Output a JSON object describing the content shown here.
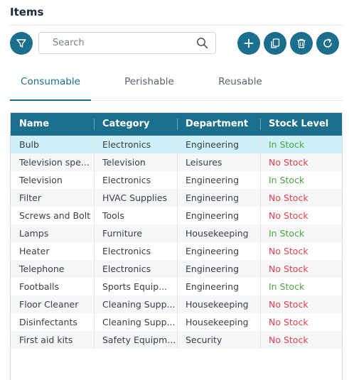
{
  "page": {
    "title": "Items"
  },
  "toolbar": {
    "filter_icon": "filter-icon",
    "search_placeholder": "Search",
    "search_value": "",
    "search_icon": "search-icon",
    "actions": [
      {
        "name": "add-button",
        "icon": "plus-icon"
      },
      {
        "name": "copy-button",
        "icon": "copy-icon"
      },
      {
        "name": "delete-button",
        "icon": "trash-icon"
      },
      {
        "name": "refresh-button",
        "icon": "refresh-icon"
      }
    ],
    "accent_color": "#1b6e8c"
  },
  "tabs": [
    {
      "label": "Consumable",
      "active": true
    },
    {
      "label": "Perishable",
      "active": false
    },
    {
      "label": "Reusable",
      "active": false
    }
  ],
  "table": {
    "columns": [
      "Name",
      "Category",
      "Department",
      "Stock Level"
    ],
    "rows": [
      {
        "name": "Bulb",
        "category": "Electronics",
        "department": "Engineering",
        "stock": "In Stock",
        "selected": true
      },
      {
        "name": "Television spe...",
        "category": "Television",
        "department": "Leisures",
        "stock": "No Stock"
      },
      {
        "name": "Television",
        "category": "Electronics",
        "department": "Engineering",
        "stock": "In Stock"
      },
      {
        "name": "Filter",
        "category": "HVAC Supplies",
        "department": "Engineering",
        "stock": "No Stock"
      },
      {
        "name": "Screws and Bolt",
        "category": "Tools",
        "department": "Engineering",
        "stock": "No Stock"
      },
      {
        "name": "Lamps",
        "category": "Furniture",
        "department": "Housekeeping",
        "stock": "In Stock"
      },
      {
        "name": "Heater",
        "category": "Electronics",
        "department": "Engineering",
        "stock": "No Stock"
      },
      {
        "name": "Telephone",
        "category": "Electronics",
        "department": "Engineering",
        "stock": "No Stock"
      },
      {
        "name": "Footballs",
        "category": "Sports Equip...",
        "department": "Engineering",
        "stock": "In Stock"
      },
      {
        "name": "Floor Cleaner",
        "category": "Cleaning Supp...",
        "department": "Housekeeping",
        "stock": "No Stock"
      },
      {
        "name": "Disinfectants",
        "category": "Cleaning Supp...",
        "department": "Housekeeping",
        "stock": "No Stock"
      },
      {
        "name": "First aid kits",
        "category": "Safety Equipm...",
        "department": "Security",
        "stock": "No Stock"
      }
    ],
    "colors": {
      "in_stock": "#4aa63c",
      "no_stock": "#e3414a",
      "header_bg": "#1b6e8c",
      "selected_row": "#cdf1f7"
    }
  }
}
